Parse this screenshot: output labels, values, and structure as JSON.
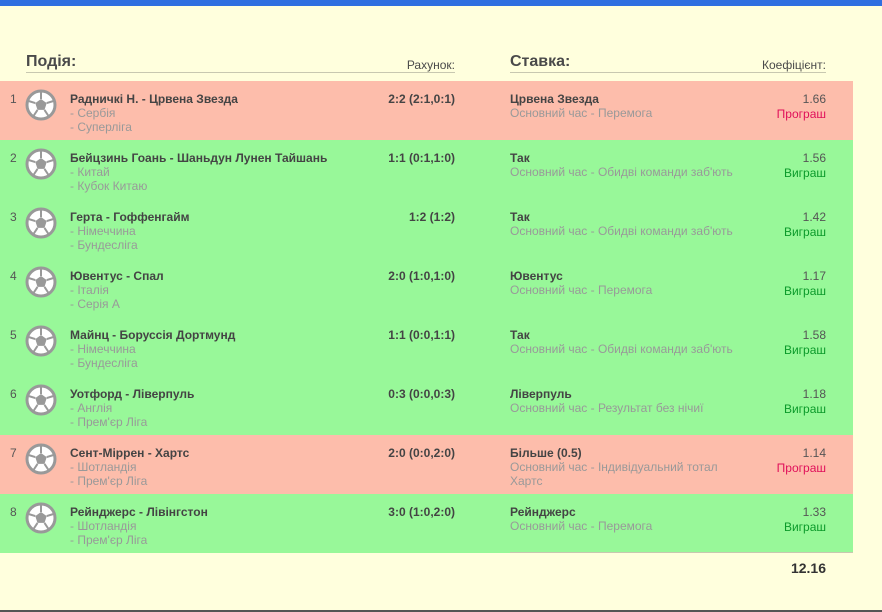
{
  "headers": {
    "event": "Подія:",
    "score": "Рахунок:",
    "bet": "Ставка:",
    "odds": "Коефіцієнт:"
  },
  "colors": {
    "won_row": "#98f899",
    "lost_row": "#fdbdab",
    "won_text": "#0b9a2a",
    "lost_text": "#e0105a",
    "top_bar": "#2f6fe0",
    "background": "#ffffdd"
  },
  "row_icon": "soccer-ball-icon",
  "rows": [
    {
      "num": "1",
      "event": "Радничкі Н. - Црвена Звезда",
      "country": "- Сербія",
      "league": "- Суперліга",
      "score": "2:2 (2:1,0:1)",
      "bet": "Црвена Звезда",
      "bet_desc": "Основний час - Перемога",
      "odds": "1.66",
      "status": "Програш",
      "result": "lost"
    },
    {
      "num": "2",
      "event": "Бейцзинь Гоань - Шаньдун Лунен Тайшань",
      "country": "- Китай",
      "league": "- Кубок Китаю",
      "score": "1:1 (0:1,1:0)",
      "bet": "Так",
      "bet_desc": "Основний час - Обидві команди заб'ють",
      "odds": "1.56",
      "status": "Виграш",
      "result": "won"
    },
    {
      "num": "3",
      "event": "Герта - Гоффенгайм",
      "country": "- Німеччина",
      "league": "- Бундесліга",
      "score": "1:2 (1:2)",
      "bet": "Так",
      "bet_desc": "Основний час - Обидві команди заб'ють",
      "odds": "1.42",
      "status": "Виграш",
      "result": "won"
    },
    {
      "num": "4",
      "event": "Ювентус - Спал",
      "country": "- Італія",
      "league": "- Серія А",
      "score": "2:0 (1:0,1:0)",
      "bet": "Ювентус",
      "bet_desc": "Основний час - Перемога",
      "odds": "1.17",
      "status": "Виграш",
      "result": "won"
    },
    {
      "num": "5",
      "event": "Майнц - Боруссія Дортмунд",
      "country": "- Німеччина",
      "league": "- Бундесліга",
      "score": "1:1 (0:0,1:1)",
      "bet": "Так",
      "bet_desc": "Основний час - Обидві команди заб'ють",
      "odds": "1.58",
      "status": "Виграш",
      "result": "won"
    },
    {
      "num": "6",
      "event": "Уотфорд - Ліверпуль",
      "country": "- Англія",
      "league": "- Прем'єр Ліга",
      "score": "0:3 (0:0,0:3)",
      "bet": "Ліверпуль",
      "bet_desc": "Основний час - Результат без нічиї",
      "odds": "1.18",
      "status": "Виграш",
      "result": "won"
    },
    {
      "num": "7",
      "event": "Сент-Міррен - Хартс",
      "country": "- Шотландія",
      "league": "- Прем'єр Ліга",
      "score": "2:0 (0:0,2:0)",
      "bet": "Більше (0.5)",
      "bet_desc": "Основний час - Індивідуальний тотал Хартс",
      "odds": "1.14",
      "status": "Програш",
      "result": "lost"
    },
    {
      "num": "8",
      "event": "Рейнджерс - Лівінгстон",
      "country": "- Шотландія",
      "league": "- Прем'єр Ліга",
      "score": "3:0 (1:0,2:0)",
      "bet": "Рейнджерс",
      "bet_desc": "Основний час - Перемога",
      "odds": "1.33",
      "status": "Виграш",
      "result": "won"
    }
  ],
  "total_odds": "12.16"
}
